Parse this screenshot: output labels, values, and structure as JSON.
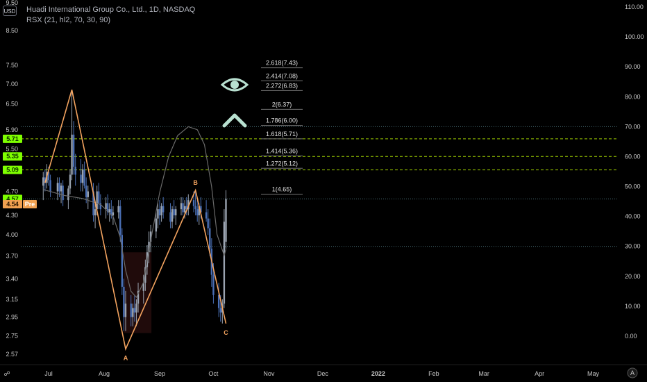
{
  "header": {
    "title": "Huadi International Group Co., Ltd., 1D, NASDAQ",
    "indicator": "RSX (21, hl2, 70, 30, 90)",
    "currency": "USD"
  },
  "colors": {
    "background": "#000000",
    "candle_up": "#9aa3b0",
    "candle_down": "#4a6fb5",
    "wave_line": "#f4a460",
    "fib_line": "#a0d000",
    "rsx_line": "#6a6a6a",
    "price_tag_green": "#7fff00",
    "price_tag_orange": "#f0a050",
    "eye_icon": "#b8e0d0"
  },
  "axes": {
    "left_ticks": [
      "9.50",
      "8.50",
      "7.50",
      "7.00",
      "6.50",
      "5.90",
      "5.50",
      "4.70",
      "4.30",
      "4.00",
      "3.70",
      "3.40",
      "3.15",
      "2.95",
      "2.75",
      "2.57"
    ],
    "right_ticks": [
      "110.00",
      "100.00",
      "90.00",
      "80.00",
      "70.00",
      "60.00",
      "50.00",
      "40.00",
      "30.00",
      "20.00",
      "10.00",
      "0.00"
    ],
    "x_ticks": [
      "Jul",
      "Aug",
      "Sep",
      "Oct",
      "Nov",
      "Dec",
      "2022",
      "Feb",
      "Mar",
      "Apr",
      "May"
    ],
    "y_range": [
      2.57,
      9.5
    ],
    "rsx_range": [
      0,
      110
    ],
    "scale": "log"
  },
  "price_tags": [
    {
      "label": "5.71",
      "value": 5.71,
      "style": "green"
    },
    {
      "label": "5.35",
      "value": 5.35,
      "style": "green"
    },
    {
      "label": "5.09",
      "value": 5.09,
      "style": "green"
    },
    {
      "label": "4.57",
      "value": 4.57,
      "style": "green"
    },
    {
      "label": "4.54",
      "value": 4.54,
      "style": "orange",
      "suffix": "Pre"
    }
  ],
  "fib_levels": [
    {
      "label": "2.618(7.43)",
      "value": 7.43
    },
    {
      "label": "2.414(7.08)",
      "value": 7.08
    },
    {
      "label": "2.272(6.83)",
      "value": 6.83
    },
    {
      "label": "2(6.37)",
      "value": 6.37
    },
    {
      "label": "1.786(6.00)",
      "value": 6.0
    },
    {
      "label": "1.618(5.71)",
      "value": 5.71
    },
    {
      "label": "1.414(5.36)",
      "value": 5.36
    },
    {
      "label": "1.272(5.12)",
      "value": 5.12
    },
    {
      "label": "1(4.65)",
      "value": 4.65
    }
  ],
  "wave_points": [
    {
      "label": "",
      "date": "2021-06-29",
      "price": 4.85
    },
    {
      "label": "",
      "date": "2021-07-14",
      "price": 6.85
    },
    {
      "label": "A",
      "date": "2021-08-13",
      "price": 2.62
    },
    {
      "label": "B",
      "date": "2021-09-21",
      "price": 4.72
    },
    {
      "label": "C",
      "date": "2021-10-08",
      "price": 2.88
    }
  ],
  "rsx_guides": [
    70,
    30
  ],
  "chart_data": {
    "type": "candlestick",
    "title": "Huadi International Group Co., Ltd., 1D, NASDAQ",
    "series": [
      {
        "name": "price",
        "candles": [
          {
            "d": "2021-06-28",
            "o": 4.8,
            "h": 5.05,
            "l": 4.55,
            "c": 4.95
          },
          {
            "d": "2021-06-29",
            "o": 4.95,
            "h": 5.1,
            "l": 4.7,
            "c": 4.85
          },
          {
            "d": "2021-06-30",
            "o": 4.85,
            "h": 5.2,
            "l": 4.75,
            "c": 5.05
          },
          {
            "d": "2021-07-01",
            "o": 5.05,
            "h": 5.15,
            "l": 4.8,
            "c": 4.9
          },
          {
            "d": "2021-07-02",
            "o": 4.9,
            "h": 5.0,
            "l": 4.6,
            "c": 4.7
          },
          {
            "d": "2021-07-06",
            "o": 4.7,
            "h": 4.95,
            "l": 4.55,
            "c": 4.85
          },
          {
            "d": "2021-07-07",
            "o": 4.85,
            "h": 4.95,
            "l": 4.6,
            "c": 4.7
          },
          {
            "d": "2021-07-08",
            "o": 4.7,
            "h": 4.85,
            "l": 4.5,
            "c": 4.8
          },
          {
            "d": "2021-07-09",
            "o": 4.8,
            "h": 4.9,
            "l": 4.45,
            "c": 4.55
          },
          {
            "d": "2021-07-12",
            "o": 4.55,
            "h": 4.8,
            "l": 4.4,
            "c": 4.75
          },
          {
            "d": "2021-07-13",
            "o": 4.75,
            "h": 5.1,
            "l": 4.65,
            "c": 5.0
          },
          {
            "d": "2021-07-14",
            "o": 5.0,
            "h": 6.85,
            "l": 4.9,
            "c": 5.8
          },
          {
            "d": "2021-07-15",
            "o": 5.8,
            "h": 6.1,
            "l": 5.0,
            "c": 5.15
          },
          {
            "d": "2021-07-16",
            "o": 5.15,
            "h": 5.4,
            "l": 4.8,
            "c": 5.0
          },
          {
            "d": "2021-07-19",
            "o": 5.0,
            "h": 5.3,
            "l": 4.7,
            "c": 4.85
          },
          {
            "d": "2021-07-20",
            "o": 4.85,
            "h": 5.2,
            "l": 4.7,
            "c": 5.1
          },
          {
            "d": "2021-07-21",
            "o": 5.1,
            "h": 5.25,
            "l": 4.75,
            "c": 4.8
          },
          {
            "d": "2021-07-22",
            "o": 4.8,
            "h": 4.95,
            "l": 4.5,
            "c": 4.6
          },
          {
            "d": "2021-07-23",
            "o": 4.6,
            "h": 4.8,
            "l": 4.4,
            "c": 4.7
          },
          {
            "d": "2021-07-26",
            "o": 4.7,
            "h": 4.85,
            "l": 4.2,
            "c": 4.3
          },
          {
            "d": "2021-07-27",
            "o": 4.3,
            "h": 4.5,
            "l": 4.1,
            "c": 4.4
          },
          {
            "d": "2021-07-28",
            "o": 4.4,
            "h": 4.8,
            "l": 4.3,
            "c": 4.7
          },
          {
            "d": "2021-07-29",
            "o": 4.7,
            "h": 4.85,
            "l": 4.4,
            "c": 4.5
          },
          {
            "d": "2021-07-30",
            "o": 4.5,
            "h": 4.65,
            "l": 4.3,
            "c": 4.4
          },
          {
            "d": "2021-08-02",
            "o": 4.4,
            "h": 4.6,
            "l": 4.25,
            "c": 4.5
          },
          {
            "d": "2021-08-03",
            "o": 4.5,
            "h": 4.65,
            "l": 4.3,
            "c": 4.35
          },
          {
            "d": "2021-08-04",
            "o": 4.35,
            "h": 4.5,
            "l": 4.2,
            "c": 4.4
          },
          {
            "d": "2021-08-05",
            "o": 4.4,
            "h": 4.55,
            "l": 4.25,
            "c": 4.3
          },
          {
            "d": "2021-08-06",
            "o": 4.3,
            "h": 4.45,
            "l": 4.15,
            "c": 4.35
          },
          {
            "d": "2021-08-09",
            "o": 4.35,
            "h": 4.55,
            "l": 4.25,
            "c": 4.45
          },
          {
            "d": "2021-08-10",
            "o": 4.45,
            "h": 4.55,
            "l": 3.9,
            "c": 4.0
          },
          {
            "d": "2021-08-11",
            "o": 4.0,
            "h": 4.1,
            "l": 3.2,
            "c": 3.3
          },
          {
            "d": "2021-08-12",
            "o": 3.3,
            "h": 3.4,
            "l": 2.8,
            "c": 2.95
          },
          {
            "d": "2021-08-13",
            "o": 2.95,
            "h": 3.25,
            "l": 2.8,
            "c": 3.1
          },
          {
            "d": "2021-08-16",
            "o": 3.1,
            "h": 3.2,
            "l": 2.85,
            "c": 2.95
          },
          {
            "d": "2021-08-17",
            "o": 2.95,
            "h": 3.1,
            "l": 2.85,
            "c": 3.05
          },
          {
            "d": "2021-08-18",
            "o": 3.05,
            "h": 3.2,
            "l": 2.9,
            "c": 3.0
          },
          {
            "d": "2021-08-19",
            "o": 3.0,
            "h": 3.15,
            "l": 2.85,
            "c": 3.1
          },
          {
            "d": "2021-08-20",
            "o": 3.1,
            "h": 3.35,
            "l": 3.0,
            "c": 3.25
          },
          {
            "d": "2021-08-23",
            "o": 3.25,
            "h": 3.45,
            "l": 3.1,
            "c": 3.35
          },
          {
            "d": "2021-08-24",
            "o": 3.35,
            "h": 3.65,
            "l": 3.25,
            "c": 3.55
          },
          {
            "d": "2021-08-25",
            "o": 3.55,
            "h": 3.85,
            "l": 3.45,
            "c": 3.75
          },
          {
            "d": "2021-08-26",
            "o": 3.75,
            "h": 4.05,
            "l": 3.6,
            "c": 3.9
          },
          {
            "d": "2021-08-27",
            "o": 3.9,
            "h": 4.15,
            "l": 3.75,
            "c": 4.05
          },
          {
            "d": "2021-08-30",
            "o": 4.05,
            "h": 4.35,
            "l": 3.95,
            "c": 4.25
          },
          {
            "d": "2021-08-31",
            "o": 4.25,
            "h": 4.5,
            "l": 4.1,
            "c": 4.4
          },
          {
            "d": "2021-09-01",
            "o": 4.4,
            "h": 4.55,
            "l": 4.15,
            "c": 4.3
          },
          {
            "d": "2021-09-02",
            "o": 4.3,
            "h": 4.5,
            "l": 4.2,
            "c": 4.45
          },
          {
            "d": "2021-09-03",
            "o": 4.45,
            "h": 4.6,
            "l": 4.25,
            "c": 4.35
          },
          {
            "d": "2021-09-07",
            "o": 4.35,
            "h": 4.5,
            "l": 4.1,
            "c": 4.2
          },
          {
            "d": "2021-09-08",
            "o": 4.2,
            "h": 4.45,
            "l": 4.1,
            "c": 4.4
          },
          {
            "d": "2021-09-09",
            "o": 4.4,
            "h": 4.55,
            "l": 4.25,
            "c": 4.3
          },
          {
            "d": "2021-09-10",
            "o": 4.3,
            "h": 4.45,
            "l": 4.15,
            "c": 4.4
          },
          {
            "d": "2021-09-13",
            "o": 4.4,
            "h": 4.6,
            "l": 4.3,
            "c": 4.5
          },
          {
            "d": "2021-09-14",
            "o": 4.5,
            "h": 4.6,
            "l": 4.3,
            "c": 4.35
          },
          {
            "d": "2021-09-15",
            "o": 4.35,
            "h": 4.55,
            "l": 4.25,
            "c": 4.45
          },
          {
            "d": "2021-09-16",
            "o": 4.45,
            "h": 4.6,
            "l": 4.3,
            "c": 4.4
          },
          {
            "d": "2021-09-17",
            "o": 4.4,
            "h": 4.65,
            "l": 4.3,
            "c": 4.55
          },
          {
            "d": "2021-09-20",
            "o": 4.55,
            "h": 4.7,
            "l": 4.35,
            "c": 4.45
          },
          {
            "d": "2021-09-21",
            "o": 4.45,
            "h": 4.72,
            "l": 4.3,
            "c": 4.4
          },
          {
            "d": "2021-09-22",
            "o": 4.4,
            "h": 4.55,
            "l": 4.2,
            "c": 4.3
          },
          {
            "d": "2021-09-23",
            "o": 4.3,
            "h": 4.5,
            "l": 4.15,
            "c": 4.45
          },
          {
            "d": "2021-09-24",
            "o": 4.45,
            "h": 4.6,
            "l": 4.25,
            "c": 4.35
          },
          {
            "d": "2021-09-27",
            "o": 4.35,
            "h": 4.55,
            "l": 4.2,
            "c": 4.25
          },
          {
            "d": "2021-09-28",
            "o": 4.25,
            "h": 4.4,
            "l": 4.0,
            "c": 4.1
          },
          {
            "d": "2021-09-29",
            "o": 4.1,
            "h": 4.25,
            "l": 3.7,
            "c": 3.8
          },
          {
            "d": "2021-09-30",
            "o": 3.8,
            "h": 3.95,
            "l": 3.3,
            "c": 3.45
          },
          {
            "d": "2021-10-01",
            "o": 3.45,
            "h": 3.6,
            "l": 3.1,
            "c": 3.2
          },
          {
            "d": "2021-10-04",
            "o": 3.2,
            "h": 3.35,
            "l": 2.95,
            "c": 3.05
          },
          {
            "d": "2021-10-05",
            "o": 3.05,
            "h": 3.2,
            "l": 2.9,
            "c": 3.0
          },
          {
            "d": "2021-10-06",
            "o": 3.0,
            "h": 3.15,
            "l": 2.88,
            "c": 3.1
          },
          {
            "d": "2021-10-07",
            "o": 3.1,
            "h": 4.4,
            "l": 3.05,
            "c": 4.2
          },
          {
            "d": "2021-10-08",
            "o": 3.9,
            "h": 4.72,
            "l": 3.8,
            "c": 4.57
          }
        ]
      }
    ],
    "xlabel": "",
    "ylabel": "",
    "ylim": [
      2.57,
      9.5
    ]
  }
}
